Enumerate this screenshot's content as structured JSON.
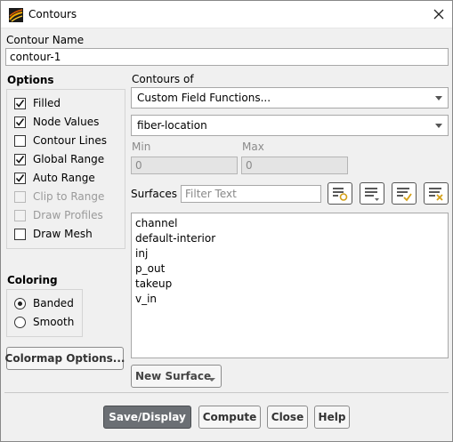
{
  "window": {
    "title": "Contours"
  },
  "contour_name": {
    "label": "Contour Name",
    "value": "contour-1"
  },
  "options": {
    "label": "Options",
    "items": [
      {
        "label": "Filled",
        "checked": true,
        "enabled": true
      },
      {
        "label": "Node Values",
        "checked": true,
        "enabled": true
      },
      {
        "label": "Contour Lines",
        "checked": false,
        "enabled": true
      },
      {
        "label": "Global Range",
        "checked": true,
        "enabled": true
      },
      {
        "label": "Auto Range",
        "checked": true,
        "enabled": true
      },
      {
        "label": "Clip to Range",
        "checked": false,
        "enabled": false
      },
      {
        "label": "Draw Profiles",
        "checked": false,
        "enabled": false
      },
      {
        "label": "Draw Mesh",
        "checked": false,
        "enabled": true
      }
    ]
  },
  "coloring": {
    "label": "Coloring",
    "options": [
      {
        "label": "Banded",
        "selected": true
      },
      {
        "label": "Smooth",
        "selected": false
      }
    ]
  },
  "colormap_button": "Colormap Options...",
  "contours_of": {
    "label": "Contours of",
    "category": "Custom Field Functions...",
    "field": "fiber-location"
  },
  "range": {
    "min_label": "Min",
    "min_value": "0",
    "max_label": "Max",
    "max_value": "0"
  },
  "surfaces": {
    "label": "Surfaces",
    "filter_placeholder": "Filter Text",
    "icons": [
      "surface-select-icon",
      "list-sort-icon",
      "select-all-icon",
      "deselect-all-icon"
    ],
    "items": [
      "channel",
      "default-interior",
      "inj",
      "p_out",
      "takeup",
      "v_in"
    ]
  },
  "new_surface_button": "New Surface",
  "footer": {
    "save_display": "Save/Display",
    "compute": "Compute",
    "close": "Close",
    "help": "Help"
  },
  "colors": {
    "accent": "#d4a017",
    "primary_button": "#6b6f74"
  }
}
